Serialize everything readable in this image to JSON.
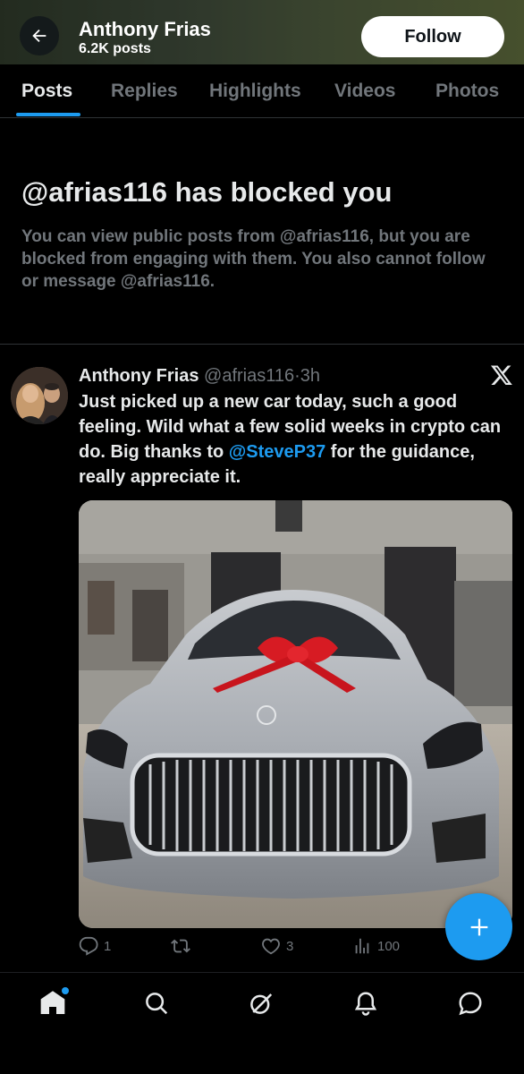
{
  "header": {
    "name": "Anthony Frias",
    "posts_count": "6.2K posts",
    "follow_label": "Follow"
  },
  "tabs": [
    {
      "label": "Posts",
      "active": true
    },
    {
      "label": "Replies",
      "active": false
    },
    {
      "label": "Highlights",
      "active": false
    },
    {
      "label": "Videos",
      "active": false
    },
    {
      "label": "Photos",
      "active": false
    }
  ],
  "blocked": {
    "title": "@afrias116 has blocked you",
    "text": "You can view public posts from @afrias116, but you are blocked from engaging with them. You also cannot follow or message @afrias116."
  },
  "post": {
    "author": "Anthony Frias",
    "handle": "@afrias116",
    "separator": "·",
    "time": "3h",
    "text_before": "Just picked up a new car today, such a good feeling. Wild what a few solid weeks in crypto can do. Big thanks to ",
    "mention": "@SteveP37",
    "text_after": " for the guidance, really appreciate it.",
    "actions": {
      "replies": "1",
      "reposts": "",
      "likes": "3",
      "views": "100"
    }
  },
  "icons": {
    "back": "arrow-left-icon",
    "x_logo": "x-logo-icon",
    "reply": "reply-icon",
    "repost": "repost-icon",
    "like": "heart-icon",
    "views": "views-icon",
    "compose": "plus-icon",
    "nav_home": "home-icon",
    "nav_search": "search-icon",
    "nav_grok": "grok-icon",
    "nav_notifications": "bell-icon",
    "nav_messages": "message-icon"
  },
  "colors": {
    "accent": "#1d9bf0",
    "background": "#000000",
    "text_primary": "#e7e9ea",
    "text_secondary": "#71767b"
  }
}
